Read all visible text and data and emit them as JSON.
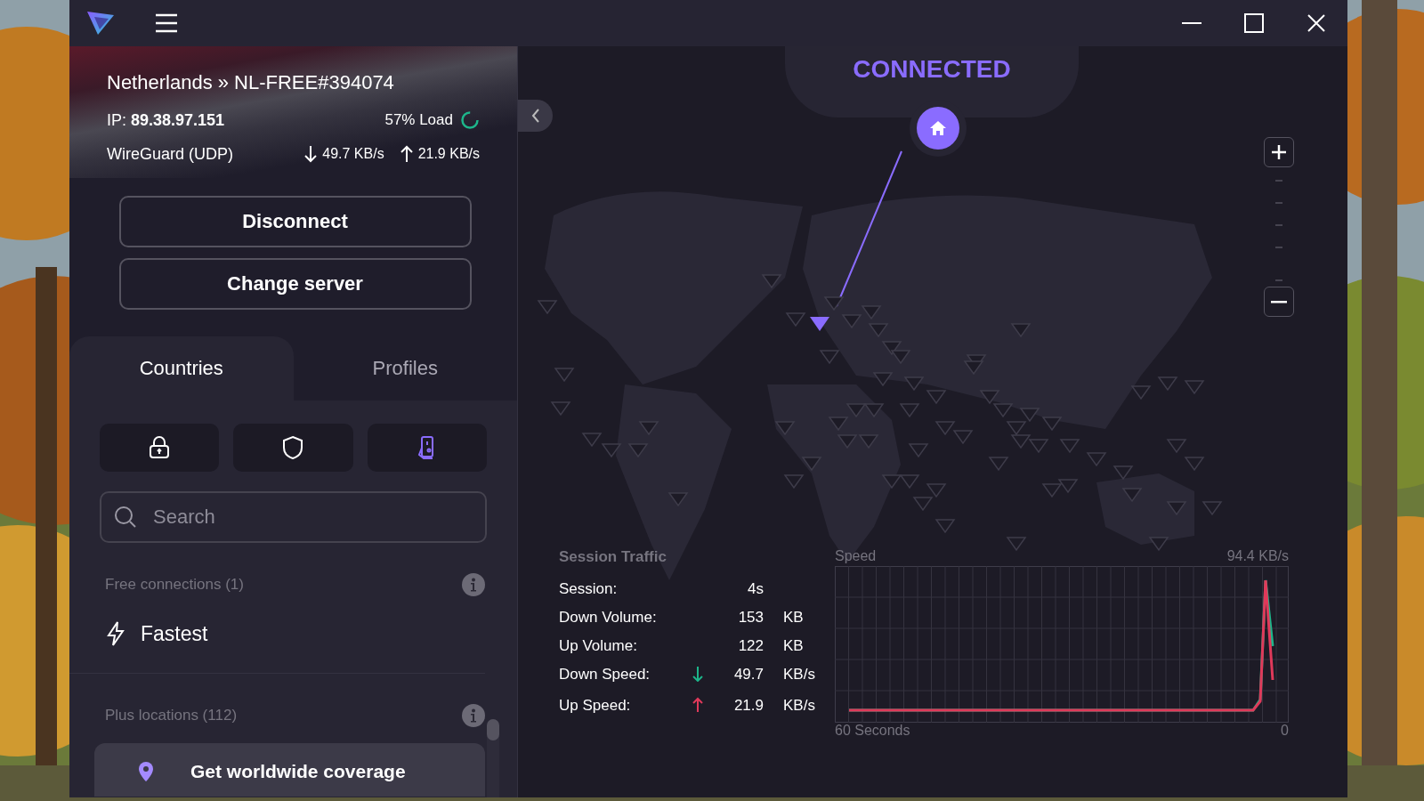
{
  "connection": {
    "server": "Netherlands » NL-FREE#394074",
    "ip_label": "IP:",
    "ip": "89.38.97.151",
    "load": "57% Load",
    "protocol": "WireGuard (UDP)",
    "down": "49.7 KB/s",
    "up": "21.9 KB/s"
  },
  "buttons": [
    "Disconnect",
    "Change server"
  ],
  "tabs": [
    {
      "label": "Countries",
      "selected": true
    },
    {
      "label": "Profiles",
      "selected": false
    }
  ],
  "filters": [
    {
      "kind": "lock",
      "selected": false
    },
    {
      "kind": "shield",
      "selected": false
    },
    {
      "kind": "phone",
      "selected": true
    }
  ],
  "search": {
    "placeholder": "Search"
  },
  "list": [
    {
      "kind": "header",
      "label": "Free connections (1)"
    },
    {
      "kind": "server",
      "label": "Fastest"
    },
    {
      "kind": "header",
      "label": "Plus locations (112)"
    },
    {
      "kind": "promo",
      "label": "Get worldwide coverage"
    }
  ],
  "status": {
    "label": "CONNECTED"
  },
  "traffic": {
    "title": "Session Traffic",
    "rows": [
      {
        "kind": "plain",
        "label": "Session:",
        "value": "4s"
      },
      {
        "kind": "plain",
        "label": "Down Volume:",
        "value": "153",
        "unit": "KB"
      },
      {
        "kind": "plain",
        "label": "Up Volume:",
        "value": "122",
        "unit": "KB"
      },
      {
        "kind": "down",
        "label": "Down Speed:",
        "value": "49.7",
        "unit": "KB/s"
      },
      {
        "kind": "up",
        "label": "Up Speed:",
        "value": "21.9",
        "unit": "KB/s"
      }
    ]
  },
  "speed_graph": {
    "title": "Speed",
    "max": "94.4 KB/s",
    "x_start": "60 Seconds",
    "x_end": "0"
  }
}
